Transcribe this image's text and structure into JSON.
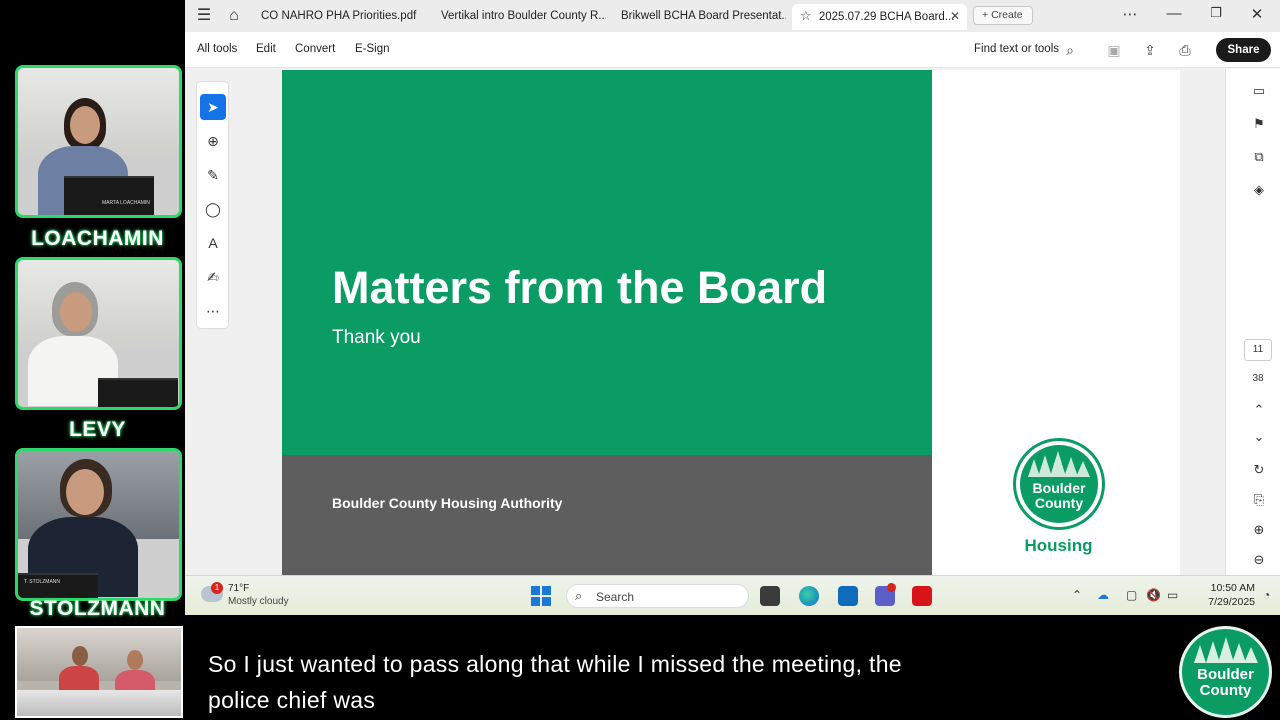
{
  "participants": [
    {
      "name": "LOACHAMIN",
      "nameplate": "MARTA LOACHAMIN"
    },
    {
      "name": "LEVY"
    },
    {
      "name": "STOLZMANN",
      "nameplate": "T. STOLZMANN"
    }
  ],
  "browser": {
    "tabs": [
      {
        "label": "CO NAHRO PHA Priorities.pdf"
      },
      {
        "label": "Vertikal intro Boulder County R..."
      },
      {
        "label": "Brikwell BCHA Board Presentat..."
      },
      {
        "label": "2025.07.29 BCHA Board..."
      }
    ],
    "create_label": "Create"
  },
  "toolbar": {
    "menus": [
      "All tools",
      "Edit",
      "Convert",
      "E-Sign"
    ],
    "find_label": "Find text or tools",
    "share_label": "Share"
  },
  "viewer": {
    "current_page": "11",
    "total_pages": "38"
  },
  "slide": {
    "title": "Matters from the Board",
    "subtitle": "Thank you",
    "footer": "Boulder County Housing Authority",
    "logo_line1": "Boulder",
    "logo_line2": "County",
    "logo_housing": "Housing",
    "green": "#0b9b64",
    "gray": "#5e5e5e"
  },
  "taskbar": {
    "weather_badge": "1",
    "temperature": "71°F",
    "weather": "Mostly cloudy",
    "search_placeholder": "Search",
    "time": "10:50 AM",
    "date": "7/29/2025"
  },
  "caption": {
    "line1": "So I just wanted to pass along that while I missed the meeting, the",
    "line2": "police chief was"
  },
  "corner_logo": {
    "line1": "Boulder",
    "line2": "County"
  }
}
